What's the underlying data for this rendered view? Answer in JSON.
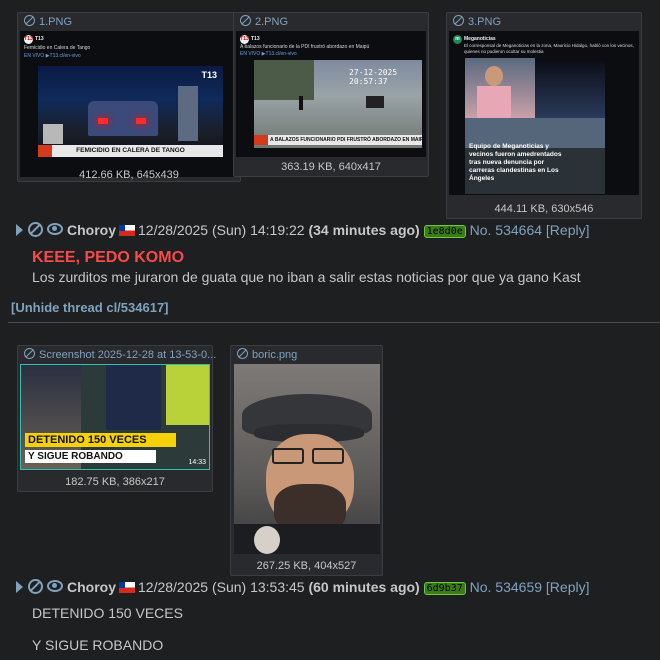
{
  "post1": {
    "files": [
      {
        "name": "1.PNG",
        "size": "412.66 KB, 645x439",
        "tweet": {
          "account": "T13",
          "headline": "Femicidio en Calera de Tango",
          "live": "EN VIVO ▶T13.cl/en-vivo"
        },
        "banner": "FEMICIDIO EN CALERA DE TANGO",
        "logo": "T13"
      },
      {
        "name": "2.PNG",
        "size": "363.19 KB, 640x417",
        "tweet": {
          "account": "T13",
          "headline": "A balazos funcionario de la PDI frustró abordazo en Maipú",
          "live": "EN VIVO ▶T13.cl/en-vivo"
        },
        "stamp": "27-12-2025 20:57:37",
        "banner": "A BALAZOS FUNCIONARIO PDI FRUSTRÓ ABORDAZO EN MAIPÚ",
        "logo": "T13"
      },
      {
        "name": "3.PNG",
        "size": "444.11 KB, 630x546",
        "tweet": {
          "account": "Meganoticias",
          "headline": "El corresponsal de Meganoticias en la zona, Mauricio Hidalgo, habló con los vecinos, quienes no pudieron ocultar su molestia",
          "live": ""
        },
        "overlay": "Equipo de Meganoticias y vecinos fueron amedrentados tras nueva denuncia por carreras clandestinas en Los Ángeles"
      }
    ],
    "name": "Choroy",
    "datetime": "12/28/2025 (Sun) 14:19:22",
    "ago": "(34 minutes ago)",
    "id": "1e8d0e",
    "no": "No. 534664",
    "reply": "[Reply]",
    "subject": "KEEE, PEDO KOMO",
    "message": "Los zurditos me juraron de guata que no iban a salir estas noticias por que ya gano Kast"
  },
  "unhide": "[Unhide thread cl/534617]",
  "post2": {
    "files": [
      {
        "name": "Screenshot 2025-12-28 at 13-53-0...",
        "size": "182.75 KB, 386x217",
        "caption1": "DETENIDO 150 VECES",
        "caption2": "Y SIGUE ROBANDO",
        "time": "14:33"
      },
      {
        "name": "boric.png",
        "size": "267.25 KB, 404x527"
      }
    ],
    "name": "Choroy",
    "datetime": "12/28/2025 (Sun) 13:53:45",
    "ago": "(60 minutes ago)",
    "id": "6d9b37",
    "no": "No. 534659",
    "reply": "[Reply]",
    "line1": "DETENIDO 150 VECES",
    "line2": "Y SIGUE ROBANDO"
  }
}
